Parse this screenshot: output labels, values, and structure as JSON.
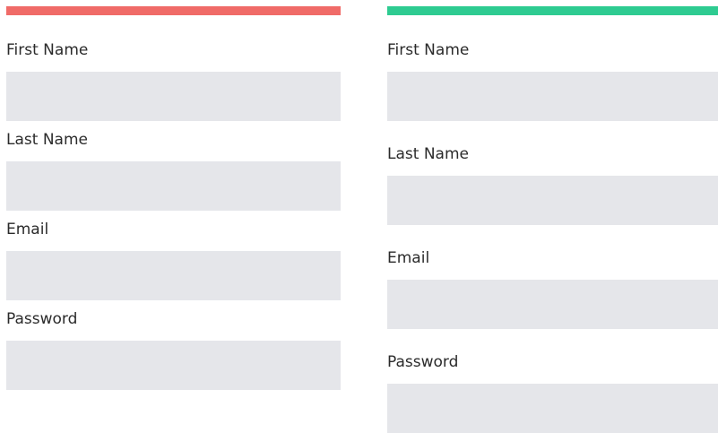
{
  "colors": {
    "left_accent": "#F06B68",
    "right_accent": "#2ECB91",
    "input_background": "#E5E6EA"
  },
  "left_form": {
    "first_name": {
      "label": "First Name",
      "value": ""
    },
    "last_name": {
      "label": "Last Name",
      "value": ""
    },
    "email": {
      "label": "Email",
      "value": ""
    },
    "password": {
      "label": "Password",
      "value": ""
    }
  },
  "right_form": {
    "first_name": {
      "label": "First Name",
      "value": ""
    },
    "last_name": {
      "label": "Last Name",
      "value": ""
    },
    "email": {
      "label": "Email",
      "value": ""
    },
    "password": {
      "label": "Password",
      "value": ""
    }
  }
}
